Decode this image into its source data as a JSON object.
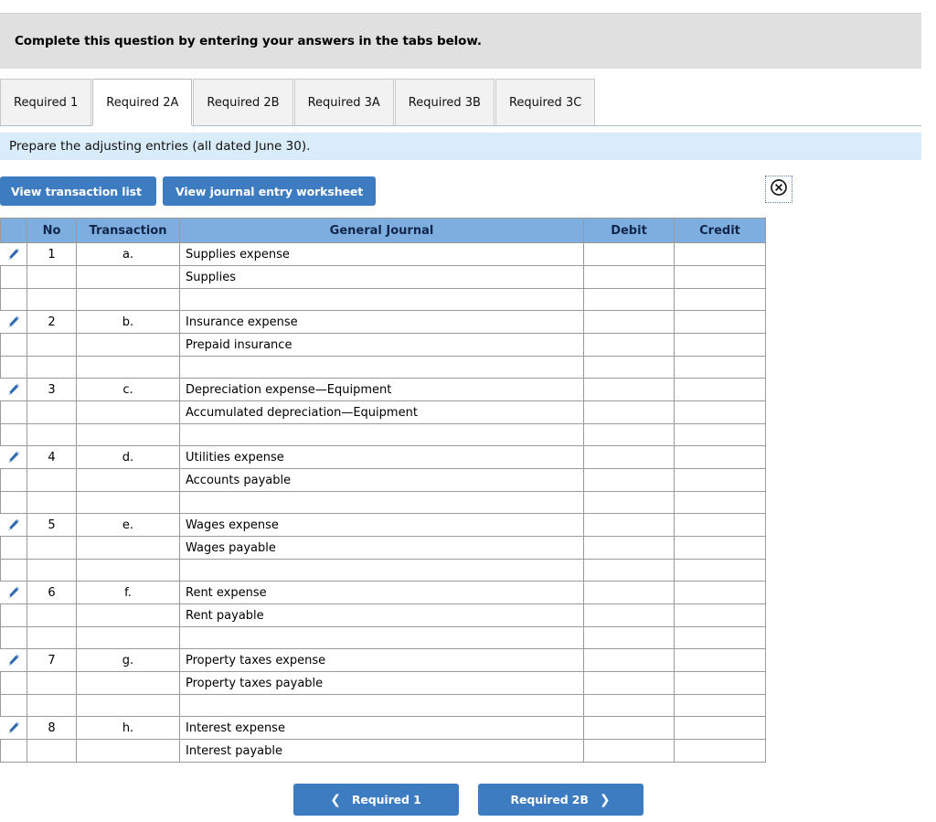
{
  "header": {
    "instruction": "Complete this question by entering your answers in the tabs below."
  },
  "tabs": [
    {
      "label": "Required 1",
      "active": false
    },
    {
      "label": "Required 2A",
      "active": true
    },
    {
      "label": "Required 2B",
      "active": false
    },
    {
      "label": "Required 3A",
      "active": false
    },
    {
      "label": "Required 3B",
      "active": false
    },
    {
      "label": "Required 3C",
      "active": false
    }
  ],
  "requirement": {
    "text": "Prepare the adjusting entries (all dated June 30)."
  },
  "toolbar": {
    "transaction_list_label": "View transaction list",
    "journal_worksheet_label": "View journal entry worksheet",
    "close_icon": "circle-x-icon"
  },
  "journal": {
    "columns": [
      "No",
      "Transaction",
      "General Journal",
      "Debit",
      "Credit"
    ],
    "edit_icon": "pencil-icon",
    "entries": [
      {
        "no": "1",
        "transaction": "a.",
        "lines": [
          {
            "account": "Supplies expense",
            "debit": "",
            "credit": ""
          },
          {
            "account": "Supplies",
            "debit": "",
            "credit": ""
          }
        ],
        "spacer": true
      },
      {
        "no": "2",
        "transaction": "b.",
        "lines": [
          {
            "account": "Insurance expense",
            "debit": "",
            "credit": ""
          },
          {
            "account": "Prepaid insurance",
            "debit": "",
            "credit": ""
          }
        ],
        "spacer": true
      },
      {
        "no": "3",
        "transaction": "c.",
        "lines": [
          {
            "account": "Depreciation expense—Equipment",
            "debit": "",
            "credit": ""
          },
          {
            "account": "Accumulated depreciation—Equipment",
            "debit": "",
            "credit": ""
          }
        ],
        "spacer": true
      },
      {
        "no": "4",
        "transaction": "d.",
        "lines": [
          {
            "account": "Utilities expense",
            "debit": "",
            "credit": ""
          },
          {
            "account": "Accounts payable",
            "debit": "",
            "credit": ""
          }
        ],
        "spacer": true
      },
      {
        "no": "5",
        "transaction": "e.",
        "lines": [
          {
            "account": "Wages expense",
            "debit": "",
            "credit": ""
          },
          {
            "account": "Wages payable",
            "debit": "",
            "credit": ""
          }
        ],
        "spacer": true
      },
      {
        "no": "6",
        "transaction": "f.",
        "lines": [
          {
            "account": "Rent expense",
            "debit": "",
            "credit": ""
          },
          {
            "account": "Rent payable",
            "debit": "",
            "credit": ""
          }
        ],
        "spacer": true
      },
      {
        "no": "7",
        "transaction": "g.",
        "lines": [
          {
            "account": "Property taxes expense",
            "debit": "",
            "credit": ""
          },
          {
            "account": "Property taxes payable",
            "debit": "",
            "credit": ""
          }
        ],
        "spacer": true
      },
      {
        "no": "8",
        "transaction": "h.",
        "lines": [
          {
            "account": "Interest expense",
            "debit": "",
            "credit": ""
          },
          {
            "account": "Interest payable",
            "debit": "",
            "credit": ""
          }
        ],
        "spacer": false
      }
    ]
  },
  "bottom_nav": {
    "prev_label": "Required 1",
    "prev_icon": "chevron-left-icon",
    "next_label": "Required 2B",
    "next_icon": "chevron-right-icon"
  },
  "colors": {
    "accent_blue": "#3d7cc0",
    "table_header_blue": "#7eaee0",
    "requirement_bar_blue": "#d9ecfa",
    "instruction_bar_gray": "#e0e0e0"
  }
}
